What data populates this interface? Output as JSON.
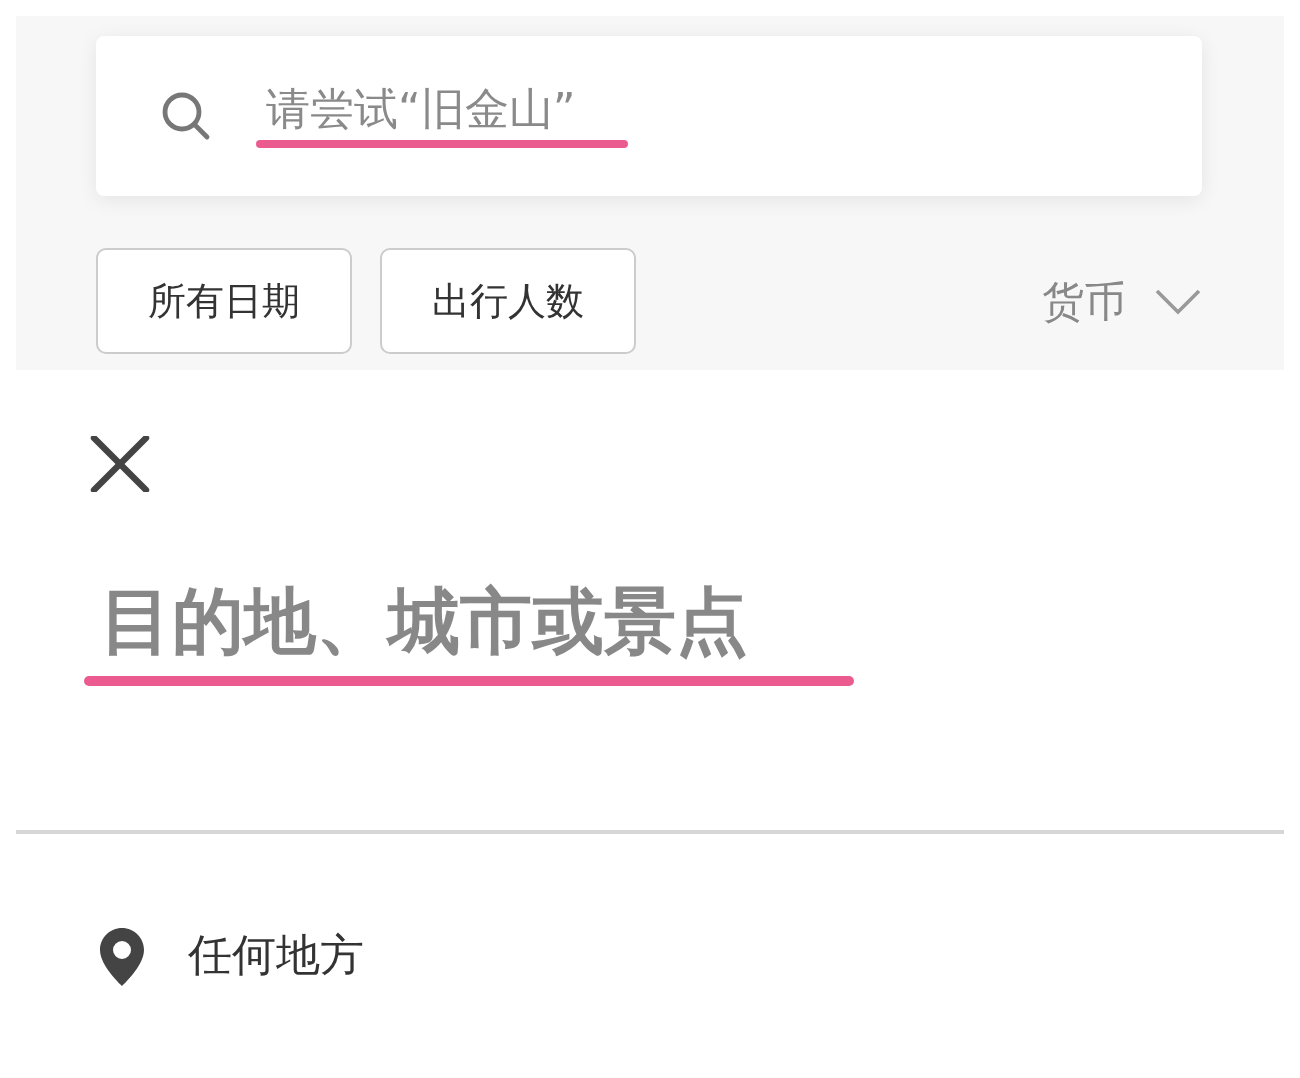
{
  "search": {
    "placeholder": "请尝试“旧金山”"
  },
  "filters": [
    {
      "label": "所有日期"
    },
    {
      "label": "出行人数"
    }
  ],
  "currency": {
    "label": "货币"
  },
  "destination": {
    "placeholder": "目的地、城市或景点"
  },
  "suggestions": [
    {
      "label": "任何地方"
    }
  ]
}
